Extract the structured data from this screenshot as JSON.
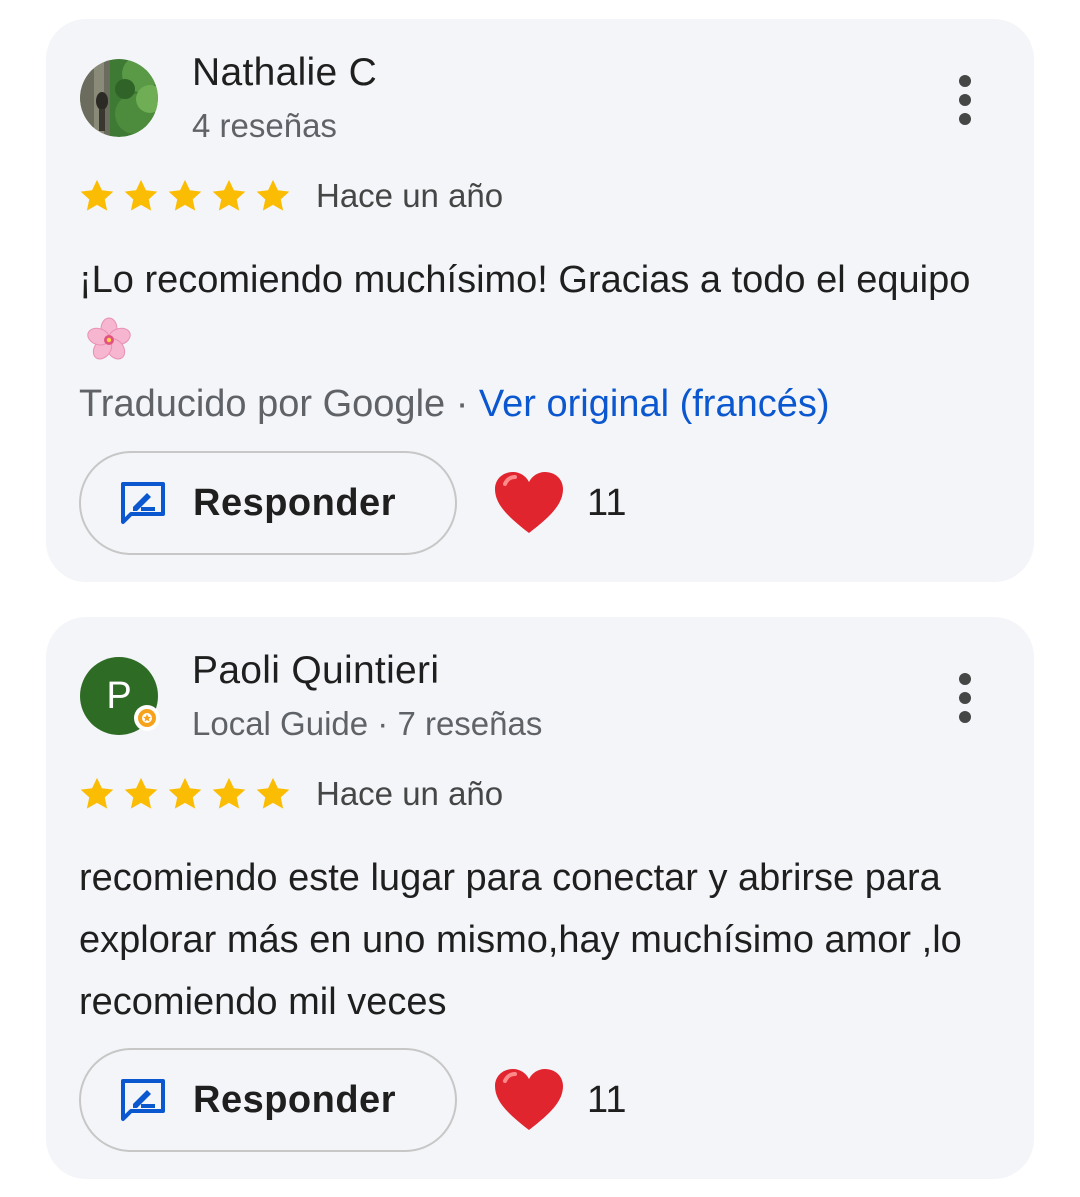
{
  "reviews": [
    {
      "author": "Nathalie C",
      "subinfo": "4 reseñas",
      "avatar_icon": "profile-photo",
      "rating": 5,
      "date": "Hace un año",
      "text": "¡Lo recomiendo muchísimo! Gracias a todo el equipo",
      "text_emoji": "cherry-blossom",
      "translated_label": "Traducido por Google",
      "separator": " · ",
      "original_link": "Ver original (francés)",
      "reply_label": "Responder",
      "like_icon": "red-heart",
      "like_count": "11"
    },
    {
      "author": "Paoli Quintieri",
      "subinfo": "Local Guide · 7 reseñas",
      "avatar_letter": "P",
      "avatar_color": "#2e6b25",
      "rating": 5,
      "date": "Hace un año",
      "text": "recomiendo este lugar para conectar y abrirse para explorar más en uno mismo,hay muchísimo amor ,lo recomiendo mil veces",
      "reply_label": "Responder",
      "like_icon": "red-heart",
      "like_count": "11"
    }
  ],
  "colors": {
    "star": "#fbbc04",
    "link": "#0b57d0",
    "card_bg": "#f4f5f8",
    "heart": "#e0252f",
    "reply_icon": "#0b57d0"
  }
}
